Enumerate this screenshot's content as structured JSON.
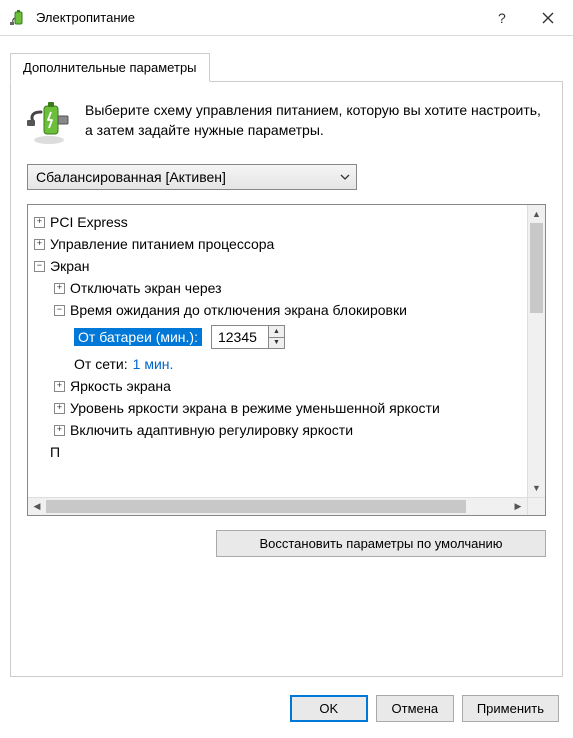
{
  "window": {
    "title": "Электропитание"
  },
  "tab": {
    "label": "Дополнительные параметры"
  },
  "intro": {
    "text": "Выберите схему управления питанием, которую вы хотите настроить, а затем задайте нужные параметры."
  },
  "scheme": {
    "selected": "Сбалансированная [Активен]"
  },
  "tree": {
    "pci": "PCI Express",
    "cpu": "Управление питанием процессора",
    "screen": "Экран",
    "screen_off": "Отключать экран через",
    "lock_timeout": "Время ожидания до отключения экрана блокировки",
    "battery_label": "От батареи (мин.):",
    "battery_value": "12345",
    "ac_label": "От сети:",
    "ac_value": "1 мин.",
    "brightness": "Яркость экрана",
    "dim_brightness": "Уровень яркости экрана в режиме уменьшенной яркости",
    "adaptive": "Включить адаптивную регулировку яркости",
    "truncated": "П"
  },
  "buttons": {
    "restore": "Восстановить параметры по умолчанию",
    "ok": "OK",
    "cancel": "Отмена",
    "apply": "Применить"
  }
}
